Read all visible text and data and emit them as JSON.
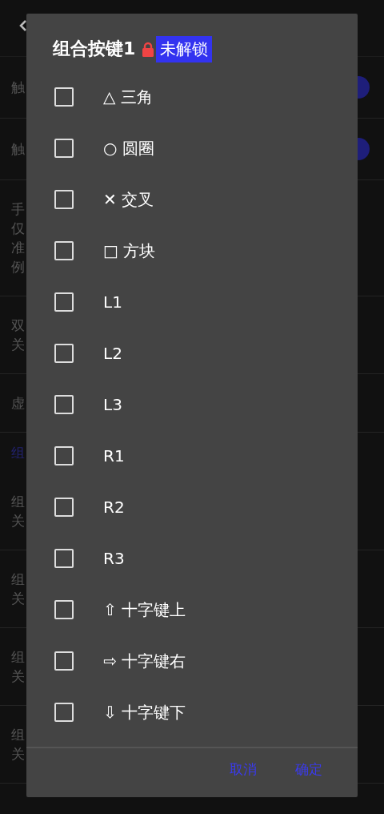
{
  "background_page": {
    "rows": [
      {
        "kind": "setting",
        "lines": [
          "触"
        ],
        "toggle": {
          "on": true
        }
      },
      {
        "kind": "setting",
        "lines": [
          "触"
        ],
        "toggle": {
          "on": true
        }
      },
      {
        "kind": "setting",
        "lines": [
          "手",
          "仅",
          "准",
          "例"
        ]
      },
      {
        "kind": "setting",
        "lines": [
          "双",
          "关"
        ]
      },
      {
        "kind": "setting",
        "lines": [
          "虚"
        ]
      },
      {
        "kind": "section",
        "lines": [
          "组"
        ]
      },
      {
        "kind": "setting",
        "lines": [
          "组",
          "关"
        ]
      },
      {
        "kind": "setting",
        "lines": [
          "组",
          "关"
        ]
      },
      {
        "kind": "setting",
        "lines": [
          "组",
          "关"
        ]
      },
      {
        "kind": "setting",
        "lines": [
          "组",
          "关"
        ]
      }
    ]
  },
  "dialog": {
    "title": "组合按键1",
    "locked": true,
    "lock_badge": "未解锁",
    "options": [
      {
        "label": "△ 三角",
        "checked": false
      },
      {
        "label": "○ 圆圈",
        "checked": false
      },
      {
        "label": "✕ 交叉",
        "checked": false
      },
      {
        "label": "□ 方块",
        "checked": false
      },
      {
        "label": "L1",
        "checked": false
      },
      {
        "label": "L2",
        "checked": false
      },
      {
        "label": "L3",
        "checked": false
      },
      {
        "label": "R1",
        "checked": false
      },
      {
        "label": "R2",
        "checked": false
      },
      {
        "label": "R3",
        "checked": false
      },
      {
        "label": "⇧ 十字键上",
        "checked": false
      },
      {
        "label": "⇨ 十字键右",
        "checked": false
      },
      {
        "label": "⇩ 十字键下",
        "checked": false
      }
    ],
    "buttons": [
      "取消",
      "确定"
    ]
  }
}
